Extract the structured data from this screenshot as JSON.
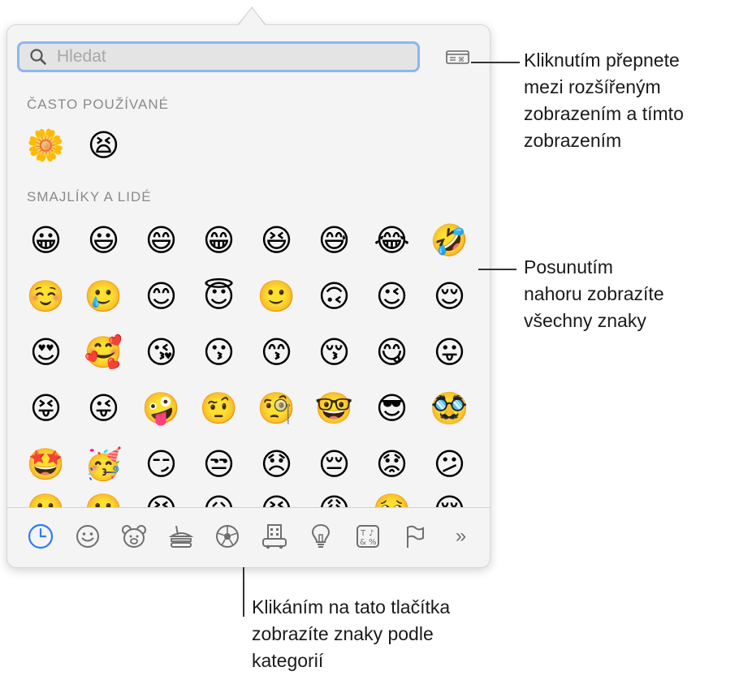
{
  "search": {
    "placeholder": "Hledat"
  },
  "view_toggle": {
    "icon": "keyboard-window-icon"
  },
  "sections": {
    "frequent": {
      "title": "ČASTO POUŽÍVANÉ",
      "emojis": [
        "🌼",
        "😫"
      ]
    },
    "smileys": {
      "title": "SMAJLÍKY A LIDÉ",
      "rows": [
        [
          "😀",
          "😃",
          "😄",
          "😁",
          "😆",
          "😅",
          "😂",
          "🤣"
        ],
        [
          "☺️",
          "🥲",
          "😊",
          "😇",
          "🙂",
          "🙃",
          "😉",
          "😌"
        ],
        [
          "😍",
          "🥰",
          "😘",
          "😗",
          "😙",
          "😚",
          "😋",
          "😛"
        ],
        [
          "😝",
          "😜",
          "🤪",
          "🤨",
          "🧐",
          "🤓",
          "😎",
          "🥸"
        ],
        [
          "🤩",
          "🥳",
          "😏",
          "😒",
          "😞",
          "😔",
          "😟",
          "😕"
        ],
        [
          "🙁",
          "☹️",
          "😣",
          "😖",
          "😫",
          "😩",
          "🥺",
          "😢"
        ]
      ]
    }
  },
  "categories": [
    {
      "name": "recent",
      "icon": "clock-icon"
    },
    {
      "name": "smileys",
      "icon": "smiley-icon"
    },
    {
      "name": "animals",
      "icon": "bear-icon"
    },
    {
      "name": "food",
      "icon": "burger-icon"
    },
    {
      "name": "activity",
      "icon": "soccer-ball-icon"
    },
    {
      "name": "travel",
      "icon": "building-icon"
    },
    {
      "name": "objects",
      "icon": "lightbulb-icon"
    },
    {
      "name": "symbols",
      "icon": "symbols-icon"
    },
    {
      "name": "flags",
      "icon": "flag-icon"
    },
    {
      "name": "more",
      "label": "»"
    }
  ],
  "colors": {
    "accent": "#2f7bf5",
    "search_focus": "#8db6ef",
    "popover_bg": "#f4f4f4"
  },
  "callouts": {
    "toggle_lines": [
      "Kliknutím přepnete",
      "mezi rozšířeným",
      "zobrazením a tímto",
      "zobrazením"
    ],
    "scroll_lines": [
      "Posunutím",
      "nahoru zobrazíte",
      "všechny znaky"
    ],
    "categories_lines": [
      "Klikáním na tato tlačítka",
      "zobrazíte znaky podle",
      "kategorií"
    ]
  }
}
